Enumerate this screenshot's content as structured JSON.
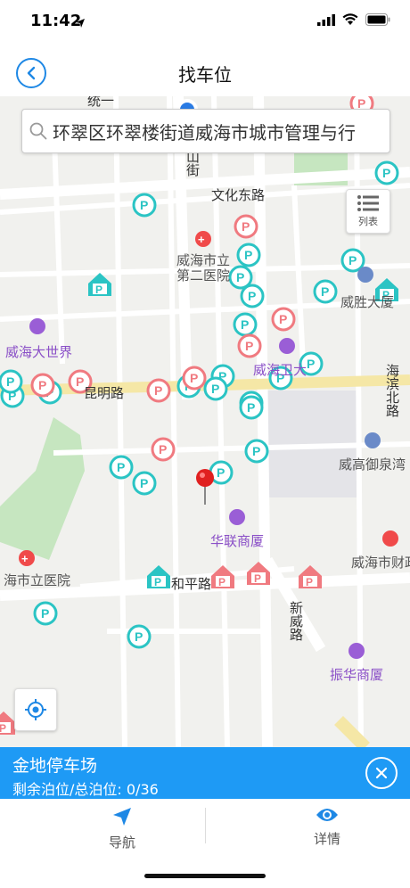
{
  "status": {
    "time": "11:42"
  },
  "nav": {
    "title": "找车位"
  },
  "search": {
    "text": "环翠区环翠楼街道威海市城市管理与行"
  },
  "map": {
    "list_button_label": "列表",
    "roads": {
      "wenhua": "文化东路",
      "kunming": "昆明路",
      "heping": "和平路",
      "xinwei": "新威路",
      "haibin": "海滨北路",
      "shanjie": "山街",
      "top": "统一"
    },
    "pois": {
      "hospital2": "威海市立第二医院",
      "weisheng": "威胜大厦",
      "dashijie": "威海大世界",
      "weihaiwei": "威海卫大",
      "yuquan": "威高御泉湾",
      "hualian": "华联商厦",
      "shili": "海市立医院",
      "caizheng": "威海市财政",
      "zhenhua": "振华商厦"
    }
  },
  "panel": {
    "name": "金地停车场",
    "stats": "剩余泊位/总泊位: 0/36"
  },
  "tabs": {
    "navigate": "导航",
    "details": "详情"
  },
  "colors": {
    "accent": "#1e9af5",
    "teal_marker": "#2bc4c4",
    "pink_marker": "#f07a80"
  }
}
